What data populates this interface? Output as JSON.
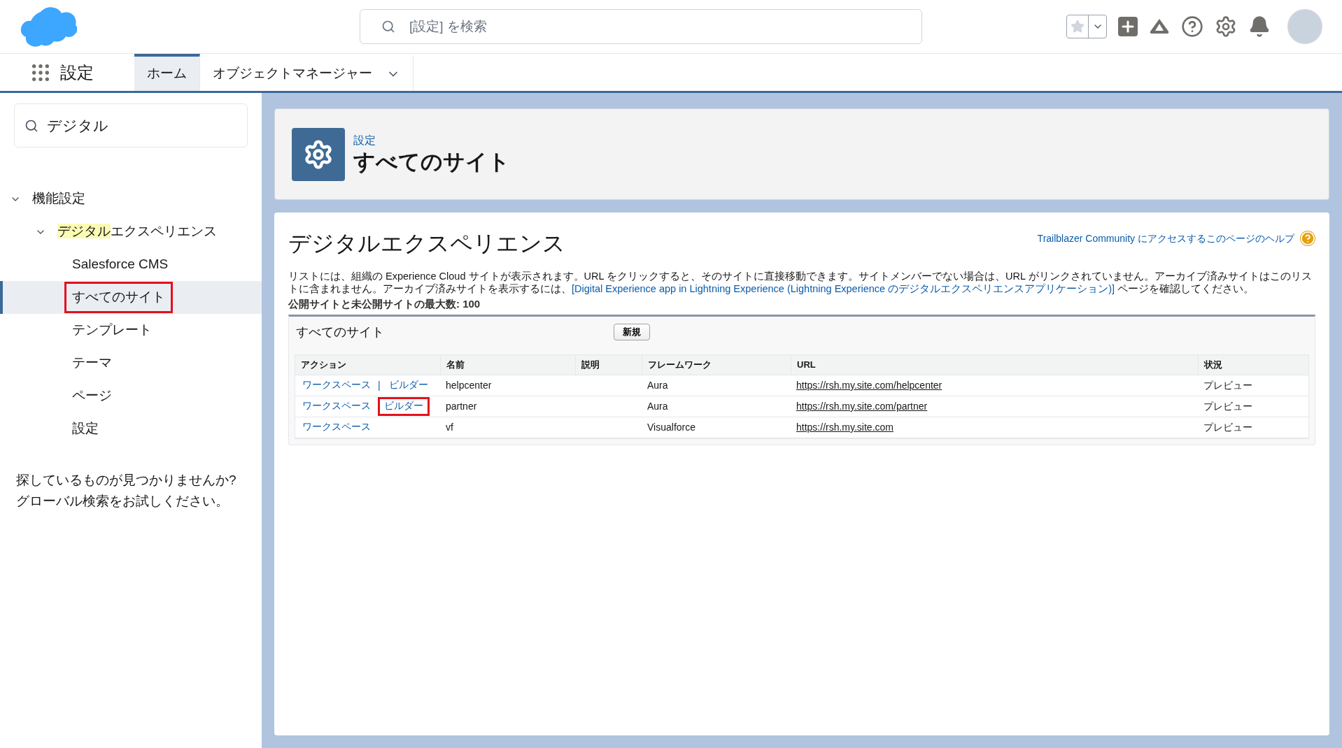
{
  "header": {
    "search_placeholder": "[設定] を検索"
  },
  "nav": {
    "app_name": "設定",
    "tabs": [
      {
        "label": "ホーム",
        "selected": true,
        "dropdown": false
      },
      {
        "label": "オブジェクトマネージャー",
        "selected": false,
        "dropdown": true
      }
    ]
  },
  "sidebar": {
    "search_value": "デジタル",
    "tree": [
      {
        "label_rest": "機能設定",
        "expanded": true,
        "children": [
          {
            "label_match": "デジタル",
            "label_rest": "エクスペリエンス",
            "expanded": true,
            "children": [
              {
                "label": "Salesforce CMS",
                "selected": false,
                "highlighted": false
              },
              {
                "label": "すべてのサイト",
                "selected": true,
                "highlighted": true
              },
              {
                "label": "テンプレート",
                "selected": false,
                "highlighted": false
              },
              {
                "label": "テーマ",
                "selected": false,
                "highlighted": false
              },
              {
                "label": "ページ",
                "selected": false,
                "highlighted": false
              },
              {
                "label": "設定",
                "selected": false,
                "highlighted": false
              }
            ]
          }
        ]
      }
    ],
    "help_lines": [
      "探しているものが見つかりませんか?",
      "グローバル検索をお試しください。"
    ]
  },
  "page_header": {
    "breadcrumb": "設定",
    "title": "すべてのサイト"
  },
  "main": {
    "title": "デジタルエクスペリエンス",
    "help_link": "Trailblazer Community にアクセスするこのページのヘルプ",
    "description_before": "リストには、組織の Experience Cloud サイトが表示されます。URL をクリックすると、そのサイトに直接移動できます。サイトメンバーでない場合は、URL がリンクされていません。アーカイブ済みサイトはこのリストに含まれません。アーカイブ済みサイトを表示するには、",
    "description_link": "[Digital Experience app in Lightning Experience (Lightning Experience のデジタルエクスペリエンスアプリケーション)]",
    "description_after": " ページを確認してください。",
    "max_sites": "公開サイトと未公開サイトの最大数: 100",
    "list": {
      "title": "すべてのサイト",
      "new_button": "新規",
      "columns": [
        "アクション",
        "名前",
        "説明",
        "フレームワーク",
        "URL",
        "状況"
      ],
      "rows": [
        {
          "workspace": "ワークスペース",
          "separator": "|",
          "builder": "ビルダー",
          "builder_highlighted": false,
          "name": "helpcenter",
          "framework": "Aura",
          "url": "https://rsh.my.site.com/helpcenter",
          "status": "プレビュー"
        },
        {
          "workspace": "ワークスペース",
          "builder": "ビルダー",
          "builder_highlighted": true,
          "name": "partner",
          "framework": "Aura",
          "url": "https://rsh.my.site.com/partner",
          "status": "プレビュー"
        },
        {
          "workspace": "ワークスペース",
          "name": "vf",
          "framework": "Visualforce",
          "url": "https://rsh.my.site.com",
          "status": "プレビュー"
        }
      ]
    }
  }
}
